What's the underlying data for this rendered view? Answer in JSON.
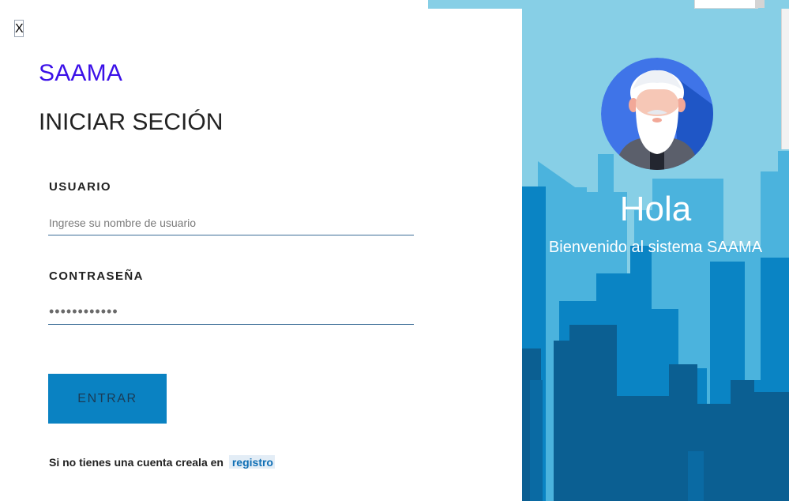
{
  "app": {
    "close_label": "X",
    "brand": "SAAMA",
    "title": "INICIAR SECIÓN"
  },
  "form": {
    "username": {
      "label": "USUARIO",
      "placeholder": "Ingrese su nombre de usuario",
      "value": ""
    },
    "password": {
      "label": "CONTRASEÑA",
      "value": "••••••••••••"
    },
    "submit_label": "ENTRAR"
  },
  "signup": {
    "text": "Si no tienes una cuenta creala en",
    "link_label": "registro"
  },
  "welcome_panel": {
    "greeting": "Hola",
    "message": "Bienvenido al sistema SAAMA",
    "avatar_icon": "user-avatar-bearded-man-icon"
  },
  "colors": {
    "brand": "#3b10e8",
    "button": "#0a82c2",
    "sky": "#87cfe6",
    "building_light": "#4bb3dd",
    "building_mid": "#0a84c4",
    "building_dark": "#0b5f92"
  }
}
